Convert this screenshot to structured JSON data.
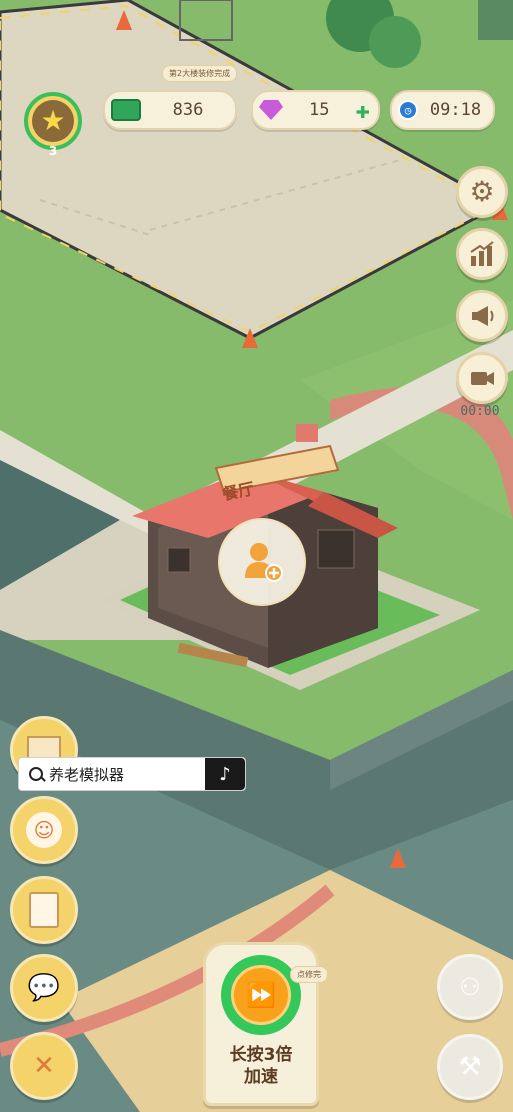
{
  "hud": {
    "level": "3",
    "money": "836",
    "gems": "15",
    "timer": "09:18",
    "task_hint": "第2大楼装修完成"
  },
  "side_menu": {
    "record_time": "00:00",
    "icons": [
      "gear-icon",
      "chart-icon",
      "megaphone-icon",
      "video-icon"
    ]
  },
  "building": {
    "sign": "餐厅"
  },
  "search": {
    "query": "养老模拟器"
  },
  "speed_button": {
    "line1": "长按3倍",
    "line2": "加速",
    "hint": "点修完"
  },
  "colors": {
    "grass": "#7fb56a",
    "plaza": "#d9d4c0",
    "roof": "#e8766a",
    "gold": "#f2c14e",
    "green_progress": "#34c759"
  }
}
